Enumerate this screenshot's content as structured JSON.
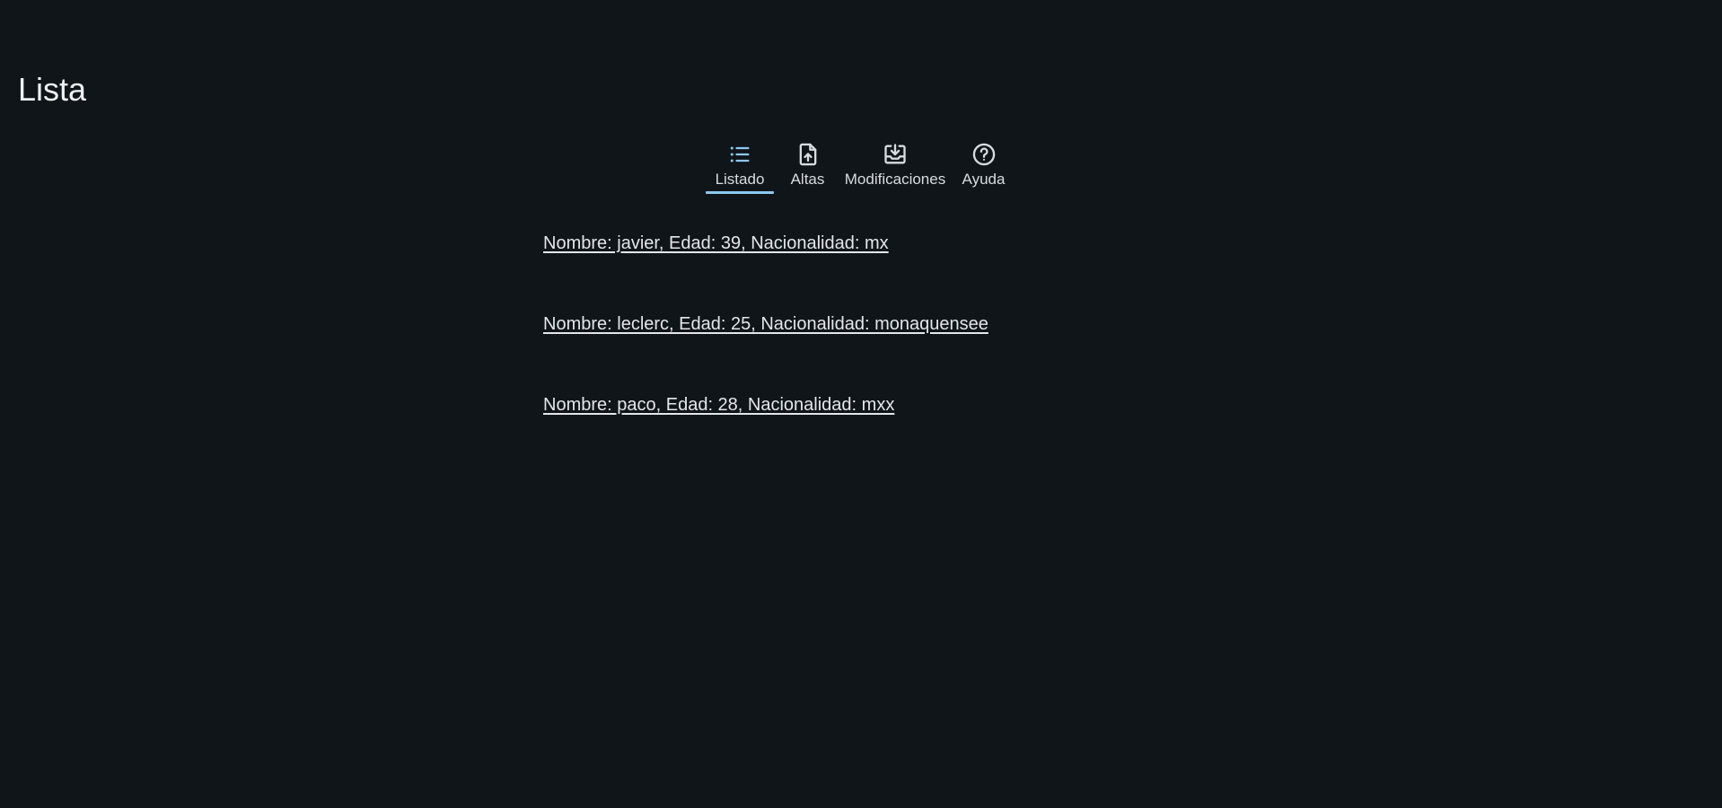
{
  "page": {
    "title": "Lista"
  },
  "tabs": [
    {
      "label": "Listado",
      "icon": "list-icon",
      "active": true
    },
    {
      "label": "Altas",
      "icon": "file-upload-icon",
      "active": false
    },
    {
      "label": "Modificaciones",
      "icon": "download-box-icon",
      "active": false
    },
    {
      "label": "Ayuda",
      "icon": "help-circle-icon",
      "active": false
    }
  ],
  "records": [
    {
      "text": "Nombre: javier, Edad: 39, Nacionalidad: mx"
    },
    {
      "text": "Nombre: leclerc, Edad: 25, Nacionalidad: monaquensee"
    },
    {
      "text": "Nombre: paco, Edad: 28, Nacionalidad: mxx"
    }
  ],
  "colors": {
    "background": "#10151a",
    "accent": "#8cc8f0",
    "text": "#e6e9ec"
  }
}
